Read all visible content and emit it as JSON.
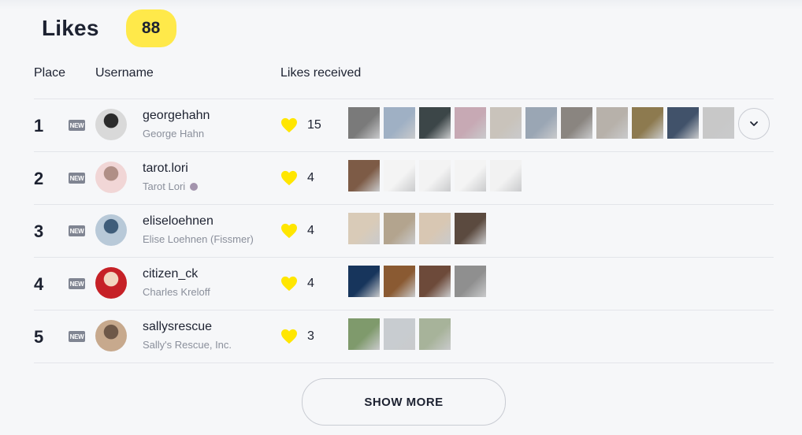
{
  "header": {
    "title": "Likes",
    "count": "88"
  },
  "columns": {
    "place": "Place",
    "username": "Username",
    "likes_received": "Likes received"
  },
  "rows": [
    {
      "place": "1",
      "badge": "NEW",
      "username": "georgehahn",
      "full_name": "George Hahn",
      "likes": "15",
      "thumb_count": 11,
      "avatar_colors": [
        "#d9d9d9",
        "#2b2b2b"
      ],
      "thumb_colors": [
        "#7a7a7a",
        "#9fb0c4",
        "#3c4648",
        "#c7a9b4",
        "#c9c3bb",
        "#9aa6b4",
        "#8a8580",
        "#b7b1aa",
        "#8d7a4f",
        "#41526a",
        "#c8c8c8"
      ]
    },
    {
      "place": "2",
      "badge": "NEW",
      "username": "tarot.lori",
      "full_name": "Tarot Lori",
      "likes": "4",
      "thumb_count": 5,
      "avatar_colors": [
        "#f1d6d6",
        "#b08f86"
      ],
      "thumb_colors": [
        "#7d5b46",
        "#f4f4f4",
        "#f3f3f3",
        "#f4f4f4",
        "#f2f2f2"
      ]
    },
    {
      "place": "3",
      "badge": "NEW",
      "username": "eliseloehnen",
      "full_name": "Elise Loehnen (Fissmer)",
      "likes": "4",
      "thumb_count": 4,
      "avatar_colors": [
        "#b8c9d8",
        "#3f5d7a"
      ],
      "thumb_colors": [
        "#d9cbb8",
        "#b3a48e",
        "#d8c7b3",
        "#5b4a3f"
      ]
    },
    {
      "place": "4",
      "badge": "NEW",
      "username": "citizen_ck",
      "full_name": "Charles Kreloff",
      "likes": "4",
      "thumb_count": 4,
      "avatar_colors": [
        "#c62127",
        "#f2d6c0"
      ],
      "thumb_colors": [
        "#17355c",
        "#8a5a32",
        "#6d4a3a",
        "#8f8f8f"
      ]
    },
    {
      "place": "5",
      "badge": "NEW",
      "username": "sallysrescue",
      "full_name": "Sally's Rescue, Inc.",
      "likes": "3",
      "thumb_count": 3,
      "avatar_colors": [
        "#c7a98d",
        "#6e5848"
      ],
      "thumb_colors": [
        "#7f9a6c",
        "#c8ccd0",
        "#a7b39a"
      ]
    }
  ],
  "show_more_label": "SHOW MORE",
  "colors": {
    "accent_yellow": "#ffe94a",
    "heart": "#ffe600",
    "badge_gray": "#808592"
  },
  "icons": {
    "heart": "heart-icon",
    "expand": "chevron-down-icon"
  }
}
